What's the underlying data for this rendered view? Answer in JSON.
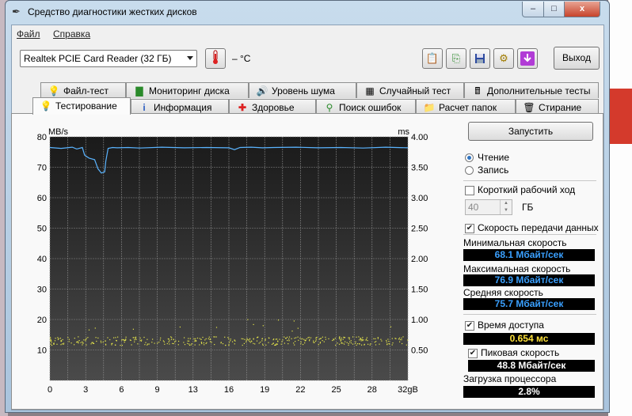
{
  "window": {
    "title": "Средство диагностики жестких дисков",
    "controls": {
      "minimize": "–",
      "maximize": "□",
      "close": "x"
    }
  },
  "menu": [
    "Файл",
    "Справка"
  ],
  "toolbar": {
    "drive": "Realtek PCIE Card Reader (32 ГБ)",
    "temperature": "– °C",
    "exit_label": "Выход",
    "icons": [
      "copy-icon",
      "copy-green-icon",
      "save-icon",
      "settings-icon",
      "download-icon"
    ]
  },
  "tabs_row1": [
    {
      "label": "Файл-тест",
      "icon": "file-icon"
    },
    {
      "label": "Мониторинг диска",
      "icon": "chart-icon"
    },
    {
      "label": "Уровень шума",
      "icon": "speaker-icon"
    },
    {
      "label": "Случайный тест",
      "icon": "random-icon"
    },
    {
      "label": "Дополнительные тесты",
      "icon": "calculator-icon"
    }
  ],
  "tabs_row2": [
    {
      "label": "Тестирование",
      "icon": "bulb-icon",
      "active": true
    },
    {
      "label": "Информация",
      "icon": "info-icon"
    },
    {
      "label": "Здоровье",
      "icon": "health-icon"
    },
    {
      "label": "Поиск ошибок",
      "icon": "search-icon"
    },
    {
      "label": "Расчет папок",
      "icon": "folder-icon"
    },
    {
      "label": "Стирание",
      "icon": "trash-icon"
    }
  ],
  "chart_data": {
    "type": "line",
    "y_left_label": "MB/s",
    "y_right_label": "ms",
    "x_ticks": [
      "0",
      "3",
      "6",
      "9",
      "13",
      "16",
      "19",
      "22",
      "25",
      "28",
      "32gB"
    ],
    "y_left_ticks": [
      "80",
      "70",
      "60",
      "50",
      "40",
      "30",
      "20",
      "10"
    ],
    "y_right_ticks": [
      "4.00",
      "3.50",
      "3.00",
      "2.50",
      "2.00",
      "1.50",
      "1.00",
      "0.50"
    ],
    "xlim": [
      0,
      32
    ],
    "ylim_left": [
      0,
      80
    ],
    "ylim_right": [
      0,
      4
    ],
    "grid": true,
    "series": [
      {
        "color": "#5ab4ff",
        "x": [
          0,
          1,
          2,
          2.4,
          2.9,
          3.1,
          3.5,
          4,
          4.3,
          4.6,
          4.9,
          5,
          5.2,
          5.6,
          6,
          7,
          8,
          10,
          12,
          14,
          16,
          16.5,
          17,
          18,
          19,
          20,
          22,
          24,
          26,
          28,
          30,
          32
        ],
        "y": [
          76.5,
          76.2,
          76.6,
          76.0,
          76.5,
          74.0,
          73.0,
          72.5,
          69.5,
          68.1,
          68.5,
          72.0,
          76.2,
          76.5,
          76.4,
          76.5,
          76.3,
          76.6,
          76.4,
          76.5,
          76.4,
          75.8,
          76.5,
          76.6,
          76.4,
          76.5,
          76.6,
          76.4,
          76.5,
          76.3,
          76.6,
          76.4
        ]
      }
    ],
    "access_time": {
      "color": "#e6e64a",
      "mean_ms": 0.654
    }
  },
  "panel": {
    "start_label": "Запустить",
    "read_label": "Чтение",
    "write_label": "Запись",
    "short_stroke_label": "Короткий рабочий ход",
    "short_stroke_value": "40",
    "gb_label": "ГБ",
    "transfer_rate_label": "Скорость передачи данных",
    "min_speed_label": "Минимальная скорость",
    "min_speed_value": "68.1 Мбайт/сек",
    "max_speed_label": "Максимальная скорость",
    "max_speed_value": "76.9 Мбайт/сек",
    "avg_speed_label": "Средняя скорость",
    "avg_speed_value": "75.7 Мбайт/сек",
    "access_time_label": "Время доступа",
    "access_time_value": "0.654 мс",
    "burst_rate_label": "Пиковая скорость",
    "burst_rate_value": "48.8 Мбайт/сек",
    "cpu_label": "Загрузка процессора",
    "cpu_value": "2.8%"
  }
}
